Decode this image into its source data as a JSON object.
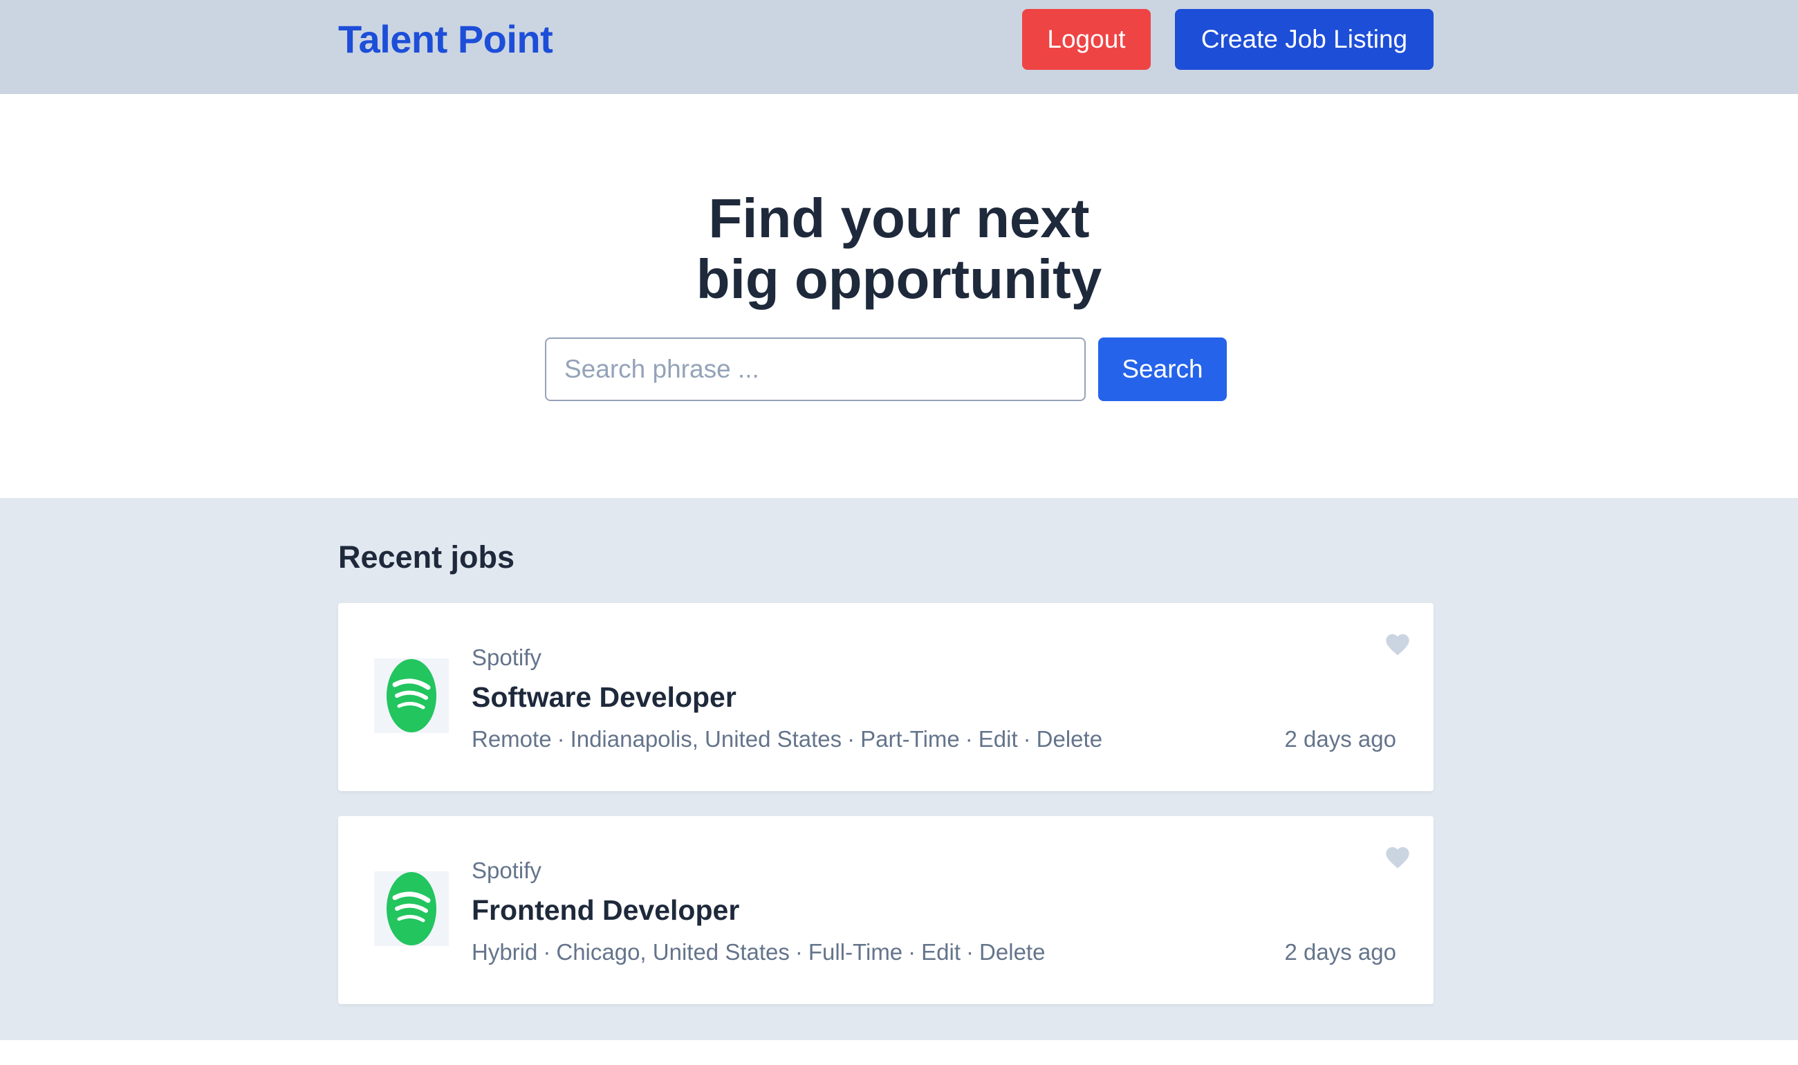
{
  "header": {
    "brand": "Talent Point",
    "logout_label": "Logout",
    "create_label": "Create Job Listing"
  },
  "hero": {
    "title_line1": "Find your next",
    "title_line2": "big opportunity",
    "search_placeholder": "Search phrase ...",
    "search_label": "Search"
  },
  "recent": {
    "title": "Recent jobs",
    "jobs": [
      {
        "company": "Spotify",
        "title": "Software Developer",
        "work_mode": "Remote",
        "location": "Indianapolis, United States",
        "type": "Part-Time",
        "edit_label": "Edit",
        "delete_label": "Delete",
        "posted": "2 days ago",
        "logo_icon": "spotify-logo"
      },
      {
        "company": "Spotify",
        "title": "Frontend Developer",
        "work_mode": "Hybrid",
        "location": "Chicago, United States",
        "type": "Full-Time",
        "edit_label": "Edit",
        "delete_label": "Delete",
        "posted": "2 days ago",
        "logo_icon": "spotify-logo"
      }
    ],
    "separator": "·"
  },
  "colors": {
    "brand": "#1d4ed8",
    "logout": "#ef4444",
    "search_button": "#2563eb",
    "header_bg": "#cbd5e1",
    "section_bg": "#e2e8f0",
    "spotify_green": "#22c55e"
  }
}
